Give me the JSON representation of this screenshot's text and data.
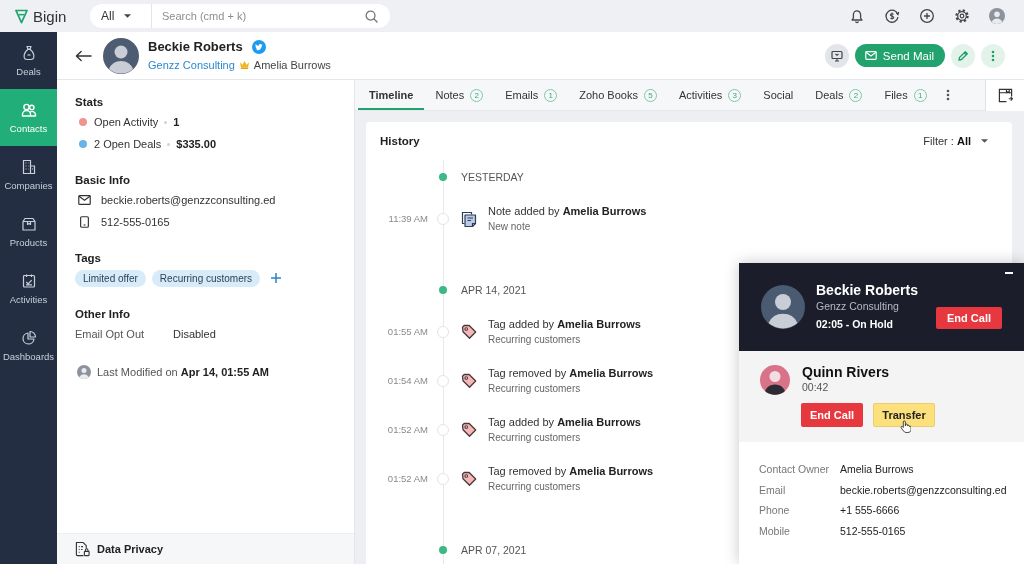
{
  "top_bar": {
    "logo": "Bigin",
    "search": {
      "scope": "All",
      "placeholder": "Search (cmd + k)"
    }
  },
  "sidebar": {
    "items": [
      {
        "label": "Deals",
        "selected": false
      },
      {
        "label": "Contacts",
        "selected": true
      },
      {
        "label": "Companies",
        "selected": false
      },
      {
        "label": "Products",
        "selected": false
      },
      {
        "label": "Activities",
        "selected": false
      },
      {
        "label": "Dashboards",
        "selected": false
      }
    ]
  },
  "header": {
    "name": "Beckie Roberts",
    "company": "Genzz Consulting",
    "owner": "Amelia Burrows",
    "send_button": "Send Mail"
  },
  "details": {
    "stats": {
      "title": "Stats",
      "items": [
        {
          "label": "Open Activity",
          "value": "1",
          "color": "#ee968c"
        },
        {
          "label": "2 Open Deals",
          "value": "$335.00",
          "color": "#6ab4e3"
        }
      ]
    },
    "basic_info": {
      "title": "Basic Info",
      "email": "beckie.roberts@genzzconsulting.ed",
      "phone": "512-555-0165"
    },
    "tags": {
      "title": "Tags",
      "items": [
        "Limited offer",
        "Recurring customers"
      ]
    },
    "other_info": {
      "title": "Other Info",
      "fields": [
        {
          "label": "Email Opt Out",
          "value": "Disabled"
        }
      ]
    },
    "last_modified": "Last Modified on **Apr 14, 01:55 AM**",
    "footer": "Data Privacy"
  },
  "tabs": [
    {
      "label": "Timeline",
      "selected": true
    },
    {
      "label": "Notes",
      "count": "2",
      "selected": false
    },
    {
      "label": "Emails",
      "count": "1",
      "selected": false
    },
    {
      "label": "Zoho Books",
      "count": "5",
      "selected": false
    },
    {
      "label": "Activities",
      "count": "3",
      "selected": false
    },
    {
      "label": "Social",
      "selected": false
    },
    {
      "label": "Deals",
      "count": "2",
      "selected": false
    },
    {
      "label": "Files",
      "count": "1",
      "selected": false
    }
  ],
  "history": {
    "title": "History",
    "filter": "Filter : **All**",
    "groups": [
      {
        "date": "YESTERDAY",
        "entries": [
          {
            "kind": "note",
            "time": "11:39 AM",
            "text": "Note added by **Amelia Burrows**",
            "detail": "New note"
          }
        ]
      },
      {
        "date": "APR 14, 2021",
        "entries": [
          {
            "kind": "tag",
            "time": "01:55 AM",
            "text": "Tag added by **Amelia Burrows**",
            "detail": "Recurring customers"
          },
          {
            "kind": "tag",
            "time": "01:54 AM",
            "text": "Tag removed by **Amelia Burrows**",
            "detail": "Recurring customers"
          },
          {
            "kind": "tag",
            "time": "01:52 AM",
            "text": "Tag added by **Amelia Burrows**",
            "detail": "Recurring customers"
          },
          {
            "kind": "tag",
            "time": "01:52 AM",
            "text": "Tag removed by **Amelia Burrows**",
            "detail": "Recurring customers"
          }
        ]
      },
      {
        "date": "APR 07, 2021"
      }
    ]
  },
  "call_panel": {
    "caller": {
      "name": "Beckie Roberts",
      "company": "Genzz Consulting",
      "status": "02:05 - On Hold",
      "end_button": "End Call"
    },
    "second_call": {
      "name": "Quinn Rivers",
      "duration": "00:42",
      "buttons": [
        {
          "label": "End Call",
          "kind": "danger",
          "hovered": false
        },
        {
          "label": "Transfer",
          "kind": "warning",
          "hovered": true
        }
      ]
    },
    "fields": [
      {
        "label": "Contact Owner",
        "value": "Amelia Burrows"
      },
      {
        "label": "Email",
        "value": "beckie.roberts@genzzconsulting.ed"
      },
      {
        "label": "Phone",
        "value": "+1 555-6666"
      },
      {
        "label": "Mobile",
        "value": "512-555-0165"
      }
    ]
  }
}
